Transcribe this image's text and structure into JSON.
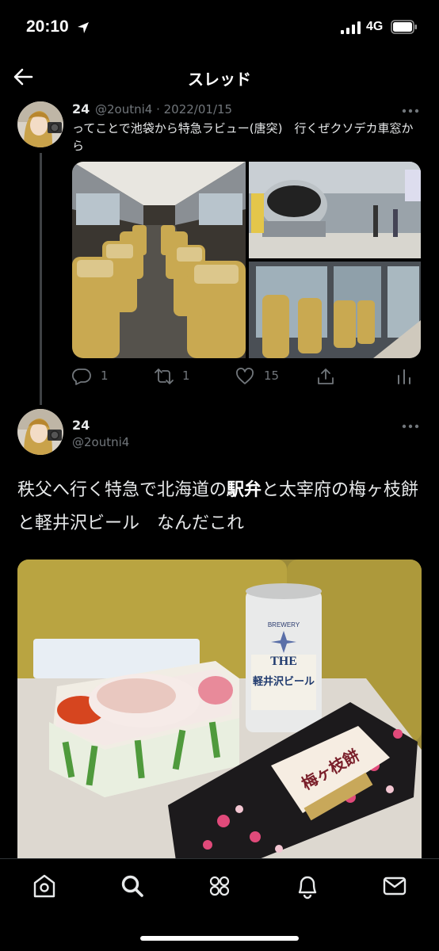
{
  "status": {
    "time": "20:10",
    "network": "4G"
  },
  "header": {
    "title": "スレッド"
  },
  "tweet1": {
    "name": "24",
    "meta": "@2outni4 · 2022/01/15",
    "text": "ってことで池袋から特急ラビュー(唐突)　行くぜクソデカ車窓から",
    "actions": {
      "reply": "1",
      "retweet": "1",
      "like": "15"
    }
  },
  "tweet2": {
    "name": "24",
    "handle": "@2outni4",
    "text_before": "秩父へ行く特急で北海道の",
    "text_bold": "駅弁",
    "text_after": "と太宰府の梅ヶ枝餅と軽井沢ビール　なんだこれ"
  },
  "photo_text": {
    "beer_title": "THE",
    "beer_name": "軽井沢ビール",
    "beer_brand": "BREWERY",
    "wrap_label": "梅ヶ枝餅"
  },
  "colors": {
    "accent": "#1d9bf0",
    "muted": "#71767b",
    "text": "#e7e9ea"
  },
  "tabs": [
    "home-icon",
    "search-icon",
    "communities-icon",
    "notifications-icon",
    "messages-icon"
  ]
}
